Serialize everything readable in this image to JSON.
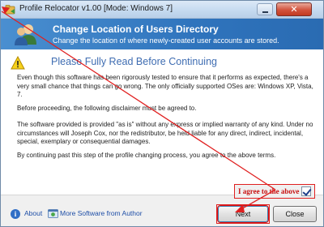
{
  "window": {
    "title": "Profile Relocator v1.00 [Mode: Windows 7]",
    "close_glyph": "✕"
  },
  "banner": {
    "title": "Change Location of Users Directory",
    "subtitle": "Change the location of where newly-created user accounts are stored."
  },
  "content": {
    "heading": "Please Fully Read Before Continuing",
    "paragraphs": [
      "Even though this software has been rigorously tested to ensure that it performs as expected, there's a very small chance that things can go wrong. The only officially supported OSes are: Windows XP, Vista, 7.",
      "Before proceeding, the following disclaimer must be agreed to.",
      "The software provided is provided \"as is\" without any express or implied warranty of any kind. Under no circumstances will Joseph Cox, nor the redistributor, be held liable for any direct, indirect, incidental, special, exemplary or consequential damages.",
      "By continuing past this step of the profile changing process, you agree to the above terms."
    ]
  },
  "agree": {
    "label": "I agree to the above",
    "checked": true
  },
  "footer": {
    "about_label": "About",
    "more_label": "More Software from Author",
    "next_label": "Next",
    "close_label": "Close",
    "info_glyph": "i"
  },
  "colors": {
    "banner": "#2f74bd",
    "annotation_red": "#e02020",
    "heading_blue": "#3f6db2"
  }
}
